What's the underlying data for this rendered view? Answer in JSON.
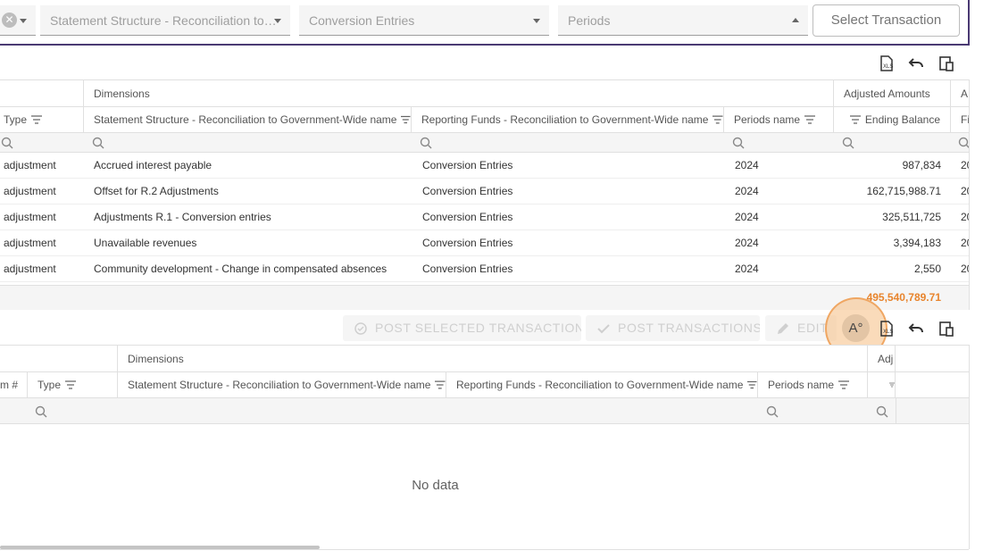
{
  "filters": {
    "first_select_value": "",
    "statement_structure_placeholder": "Statement Structure - Reconciliation to…",
    "reporting_funds_placeholder": "Conversion Entries",
    "periods_placeholder": "Periods",
    "select_transaction_label": "Select Transaction"
  },
  "top_grid": {
    "band": {
      "dimensions": "Dimensions",
      "adjusted_amounts": "Adjusted Amounts",
      "cut_label": "A"
    },
    "columns": {
      "type": "Type",
      "statement_structure": "Statement Structure - Reconciliation to Government-Wide name",
      "reporting_funds": "Reporting Funds - Reconciliation to Government-Wide name",
      "periods": "Periods name",
      "ending_balance": "Ending Balance",
      "cut": "Fi"
    },
    "rows": [
      {
        "type": "adjustment",
        "statement": "Accrued interest payable",
        "fund": "Conversion Entries",
        "period": "2024",
        "balance": "987,834",
        "cut": "20"
      },
      {
        "type": "adjustment",
        "statement": "Offset for R.2 Adjustments",
        "fund": "Conversion Entries",
        "period": "2024",
        "balance": "162,715,988.71",
        "cut": "20"
      },
      {
        "type": "adjustment",
        "statement": "Adjustments R.1 - Conversion entries",
        "fund": "Conversion Entries",
        "period": "2024",
        "balance": "325,511,725",
        "cut": "20"
      },
      {
        "type": "adjustment",
        "statement": "Unavailable revenues",
        "fund": "Conversion Entries",
        "period": "2024",
        "balance": "3,394,183",
        "cut": "20"
      },
      {
        "type": "adjustment",
        "statement": "Community development - Change in compensated absences",
        "fund": "Conversion Entries",
        "period": "2024",
        "balance": "2,550",
        "cut": "20"
      }
    ],
    "total": "495,540,789.71"
  },
  "toolbar": {
    "post_selected": "POST SELECTED TRANSACTIONS",
    "post_transactions": "POST TRANSACTIONS",
    "edit": "EDIT",
    "font_button": "A°"
  },
  "bottom_grid": {
    "band": {
      "dimensions": "Dimensions",
      "adjusted_cut": "Adj"
    },
    "columns": {
      "item_num": "m #",
      "type": "Type",
      "statement_structure": "Statement Structure - Reconciliation to Government-Wide name",
      "reporting_funds": "Reporting Funds - Reconciliation to Government-Wide name",
      "periods": "Periods name"
    },
    "no_data": "No data"
  },
  "colors": {
    "accent_border": "#4a3a73",
    "total_orange": "#e8842c",
    "highlight": "#f6be82"
  }
}
